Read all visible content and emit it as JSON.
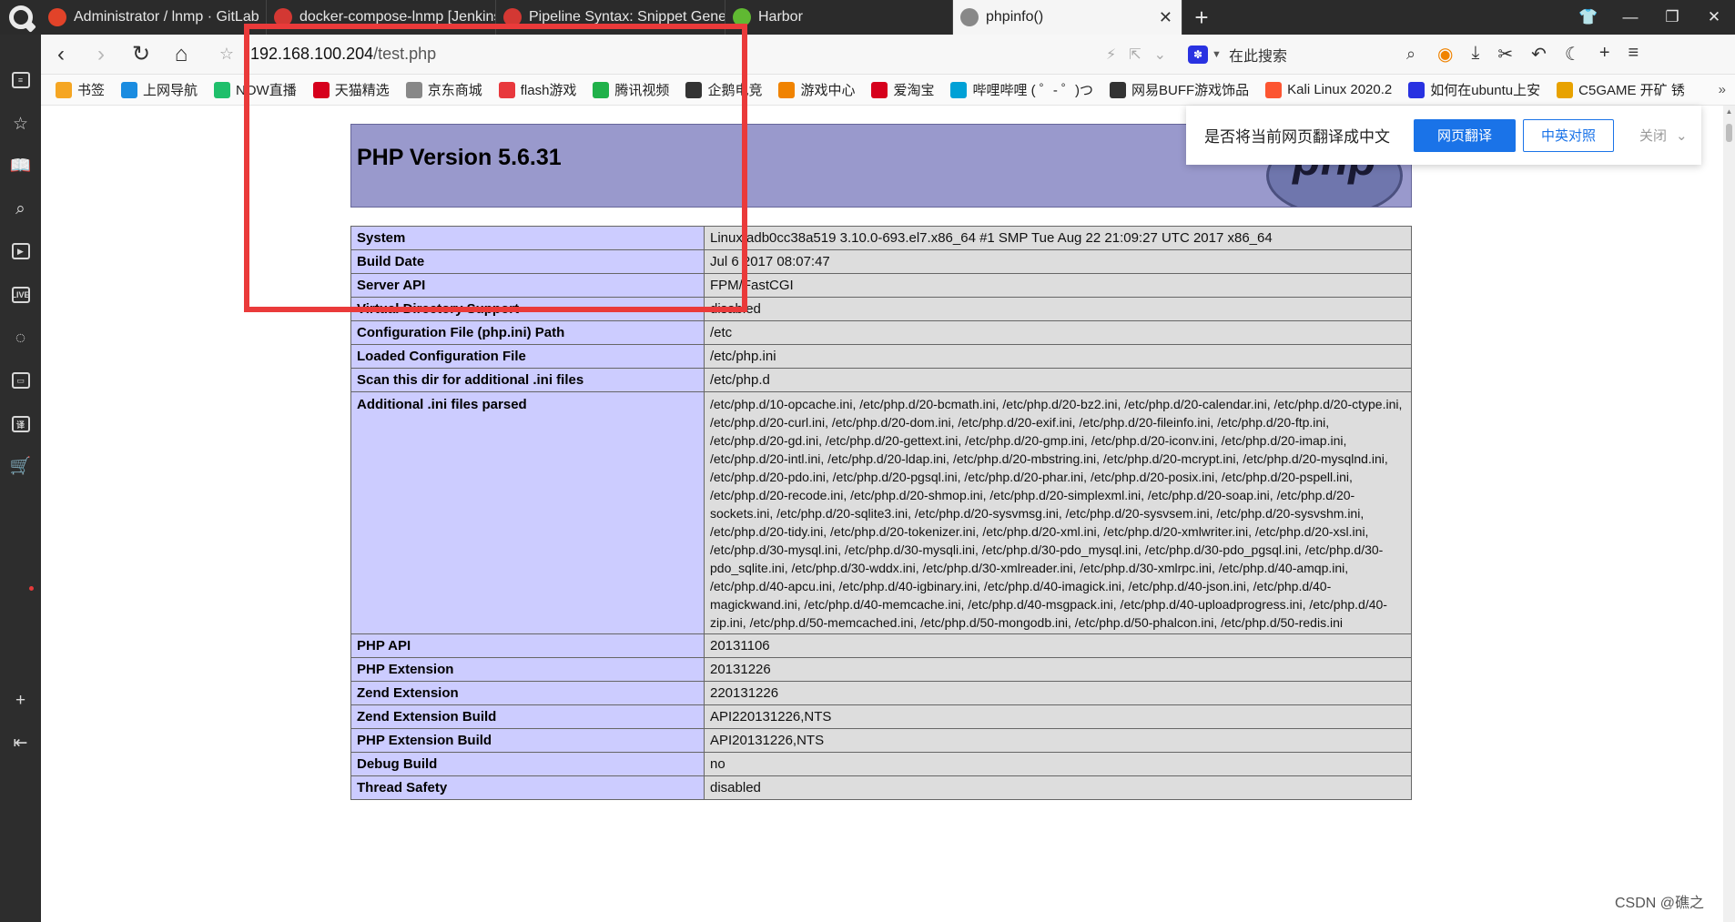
{
  "tabs": [
    {
      "label": "Administrator / lnmp · GitLab",
      "icon": "gitlab-icon",
      "color": "#e24329"
    },
    {
      "label": "docker-compose-lnmp [Jenkins]",
      "icon": "jenkins-icon",
      "color": "#d33833"
    },
    {
      "label": "Pipeline Syntax: Snippet Generator",
      "icon": "jenkins-icon",
      "color": "#d33833"
    },
    {
      "label": "Harbor",
      "icon": "harbor-icon",
      "color": "#60b932"
    },
    {
      "label": "phpinfo()",
      "icon": "globe-icon",
      "color": "#888888"
    }
  ],
  "tab_close_glyph": "✕",
  "new_tab_glyph": "+",
  "address": {
    "host": "192.168.100.204",
    "path": "/test.php"
  },
  "search": {
    "placeholder": "在此搜索"
  },
  "bookmarks": [
    {
      "label": "书签",
      "icon": "star-icon",
      "color": "#f5a623"
    },
    {
      "label": "上网导航",
      "icon": "ie-icon",
      "color": "#1a8ce0"
    },
    {
      "label": "NOW直播",
      "icon": "now-icon",
      "color": "#1fbf6b"
    },
    {
      "label": "天猫精选",
      "icon": "tmall-icon",
      "color": "#d6001c"
    },
    {
      "label": "京东商城",
      "icon": "globe-icon",
      "color": "#888888"
    },
    {
      "label": "flash游戏",
      "icon": "flash-icon",
      "color": "#e8383d"
    },
    {
      "label": "腾讯视频",
      "icon": "tencent-video-icon",
      "color": "#20b14a"
    },
    {
      "label": "企鹅电竞",
      "icon": "penguin-icon",
      "color": "#333333"
    },
    {
      "label": "游戏中心",
      "icon": "gamepad-icon",
      "color": "#f08300"
    },
    {
      "label": "爱淘宝",
      "icon": "taobao-icon",
      "color": "#d6001c"
    },
    {
      "label": "哔哩哔哩 ( ゜- ゜)つ",
      "icon": "bilibili-icon",
      "color": "#00a1d6"
    },
    {
      "label": "网易BUFF游戏饰品",
      "icon": "buff-icon",
      "color": "#333333"
    },
    {
      "label": "Kali Linux 2020.2",
      "icon": "csdn-icon",
      "color": "#fc5531"
    },
    {
      "label": "如何在ubuntu上安",
      "icon": "baidu-icon",
      "color": "#2932e1"
    },
    {
      "label": "C5GAME 开矿 锈",
      "icon": "c5game-icon",
      "color": "#e8a200"
    }
  ],
  "page": {
    "title": "PHP Version 5.6.31",
    "logo_text": "php"
  },
  "rows": [
    {
      "k": "System",
      "v": "Linux adb0cc38a519 3.10.0-693.el7.x86_64 #1 SMP Tue Aug 22 21:09:27 UTC 2017 x86_64"
    },
    {
      "k": "Build Date",
      "v": "Jul 6 2017 08:07:47"
    },
    {
      "k": "Server API",
      "v": "FPM/FastCGI"
    },
    {
      "k": "Virtual Directory Support",
      "v": "disabled"
    },
    {
      "k": "Configuration File (php.ini) Path",
      "v": "/etc"
    },
    {
      "k": "Loaded Configuration File",
      "v": "/etc/php.ini"
    },
    {
      "k": "Scan this dir for additional .ini files",
      "v": "/etc/php.d"
    },
    {
      "k": "Additional .ini files parsed",
      "v": "/etc/php.d/10-opcache.ini, /etc/php.d/20-bcmath.ini, /etc/php.d/20-bz2.ini, /etc/php.d/20-calendar.ini, /etc/php.d/20-ctype.ini, /etc/php.d/20-curl.ini, /etc/php.d/20-dom.ini, /etc/php.d/20-exif.ini, /etc/php.d/20-fileinfo.ini, /etc/php.d/20-ftp.ini, /etc/php.d/20-gd.ini, /etc/php.d/20-gettext.ini, /etc/php.d/20-gmp.ini, /etc/php.d/20-iconv.ini, /etc/php.d/20-imap.ini, /etc/php.d/20-intl.ini, /etc/php.d/20-ldap.ini, /etc/php.d/20-mbstring.ini, /etc/php.d/20-mcrypt.ini, /etc/php.d/20-mysqlnd.ini, /etc/php.d/20-pdo.ini, /etc/php.d/20-pgsql.ini, /etc/php.d/20-phar.ini, /etc/php.d/20-posix.ini, /etc/php.d/20-pspell.ini, /etc/php.d/20-recode.ini, /etc/php.d/20-shmop.ini, /etc/php.d/20-simplexml.ini, /etc/php.d/20-soap.ini, /etc/php.d/20-sockets.ini, /etc/php.d/20-sqlite3.ini, /etc/php.d/20-sysvmsg.ini, /etc/php.d/20-sysvsem.ini, /etc/php.d/20-sysvshm.ini, /etc/php.d/20-tidy.ini, /etc/php.d/20-tokenizer.ini, /etc/php.d/20-xml.ini, /etc/php.d/20-xmlwriter.ini, /etc/php.d/20-xsl.ini, /etc/php.d/30-mysql.ini, /etc/php.d/30-mysqli.ini, /etc/php.d/30-pdo_mysql.ini, /etc/php.d/30-pdo_pgsql.ini, /etc/php.d/30-pdo_sqlite.ini, /etc/php.d/30-wddx.ini, /etc/php.d/30-xmlreader.ini, /etc/php.d/30-xmlrpc.ini, /etc/php.d/40-amqp.ini, /etc/php.d/40-apcu.ini, /etc/php.d/40-igbinary.ini, /etc/php.d/40-imagick.ini, /etc/php.d/40-json.ini, /etc/php.d/40-magickwand.ini, /etc/php.d/40-memcache.ini, /etc/php.d/40-msgpack.ini, /etc/php.d/40-uploadprogress.ini, /etc/php.d/40-zip.ini, /etc/php.d/50-memcached.ini, /etc/php.d/50-mongodb.ini, /etc/php.d/50-phalcon.ini, /etc/php.d/50-redis.ini",
      "multi": true
    },
    {
      "k": "PHP API",
      "v": "20131106"
    },
    {
      "k": "PHP Extension",
      "v": "20131226"
    },
    {
      "k": "Zend Extension",
      "v": "220131226"
    },
    {
      "k": "Zend Extension Build",
      "v": "API220131226,NTS"
    },
    {
      "k": "PHP Extension Build",
      "v": "API20131226,NTS"
    },
    {
      "k": "Debug Build",
      "v": "no"
    },
    {
      "k": "Thread Safety",
      "v": "disabled"
    }
  ],
  "translate": {
    "message": "是否将当前网页翻译成中文",
    "translate_label": "网页翻译",
    "bilingual_label": "中英对照",
    "close_label": "关闭"
  },
  "watermark": "CSDN @礁之",
  "colors": {
    "annotation": "#ea3a3a",
    "php_header": "#9999cc",
    "php_key": "#ccccff",
    "php_value": "#dddddd",
    "accent": "#1a73e8"
  }
}
